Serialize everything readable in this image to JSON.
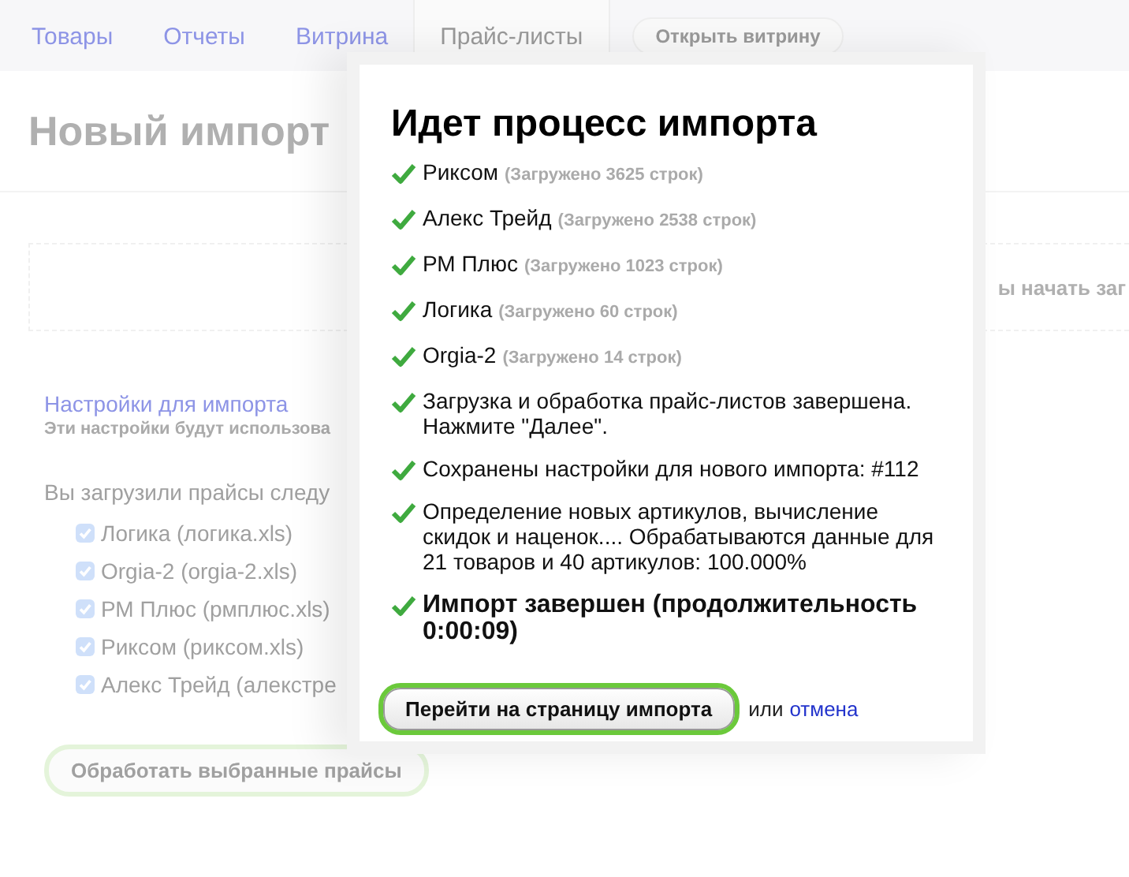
{
  "nav": {
    "tabs": [
      {
        "label": "Товары",
        "selected": false
      },
      {
        "label": "Отчеты",
        "selected": false
      },
      {
        "label": "Витрина",
        "selected": false
      },
      {
        "label": "Прайс-листы",
        "selected": true
      }
    ],
    "open_store_button": "Открыть витрину"
  },
  "page": {
    "title": "Новый импорт",
    "dropzone_hint": "ы начать заг",
    "settings": {
      "link": "Настройки для импорта",
      "hint": "Эти настройки будут использова"
    },
    "files_intro": "Вы загрузили прайсы следу",
    "files": [
      {
        "label": "Логика (логика.xls)",
        "checked": true
      },
      {
        "label": "Orgia-2 (orgia-2.xls)",
        "checked": true
      },
      {
        "label": "РМ Плюс (рмплюс.xls)",
        "checked": true
      },
      {
        "label": "Риксом (риксом.xls)",
        "checked": true
      },
      {
        "label": "Алекс Трейд (алекстре",
        "checked": true
      }
    ],
    "process_button": "Обработать выбранные прайсы"
  },
  "modal": {
    "title": "Идет процесс импорта",
    "log": [
      {
        "kind": "source",
        "text": "Риксом",
        "note": "(Загружено 3625 строк)"
      },
      {
        "kind": "source",
        "text": "Алекс Трейд",
        "note": "(Загружено 2538 строк)"
      },
      {
        "kind": "source",
        "text": "РМ Плюс",
        "note": "(Загружено 1023 строк)"
      },
      {
        "kind": "source",
        "text": "Логика",
        "note": "(Загружено 60 строк)"
      },
      {
        "kind": "source",
        "text": "Orgia-2",
        "note": "(Загружено 14 строк)"
      },
      {
        "kind": "message",
        "text": "Загрузка и обработка прайс-листов завершена. Нажмите \"Далее\"."
      },
      {
        "kind": "message",
        "text": "Сохранены настройки для нового импорта: #112"
      },
      {
        "kind": "message",
        "text": "Определение новых артикулов, вычисление скидок и наценок.... Обрабатываются данные для 21 товаров и 40 артикулов: 100.000%"
      },
      {
        "kind": "final",
        "text": "Импорт завершен (продолжительность 0:00:09)"
      }
    ],
    "primary_button": "Перейти на страницу импорта",
    "or_text": "или",
    "cancel_link": "отмена"
  }
}
